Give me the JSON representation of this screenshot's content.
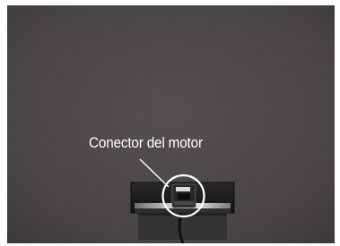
{
  "image": {
    "description_icon": "tv-back-motor-connector-photo"
  },
  "annotation": {
    "label": "Conector del motor"
  },
  "colors": {
    "panel": "#3f3b3c",
    "callout": "#ffffff",
    "connector_housing": "#1c1b1c"
  }
}
